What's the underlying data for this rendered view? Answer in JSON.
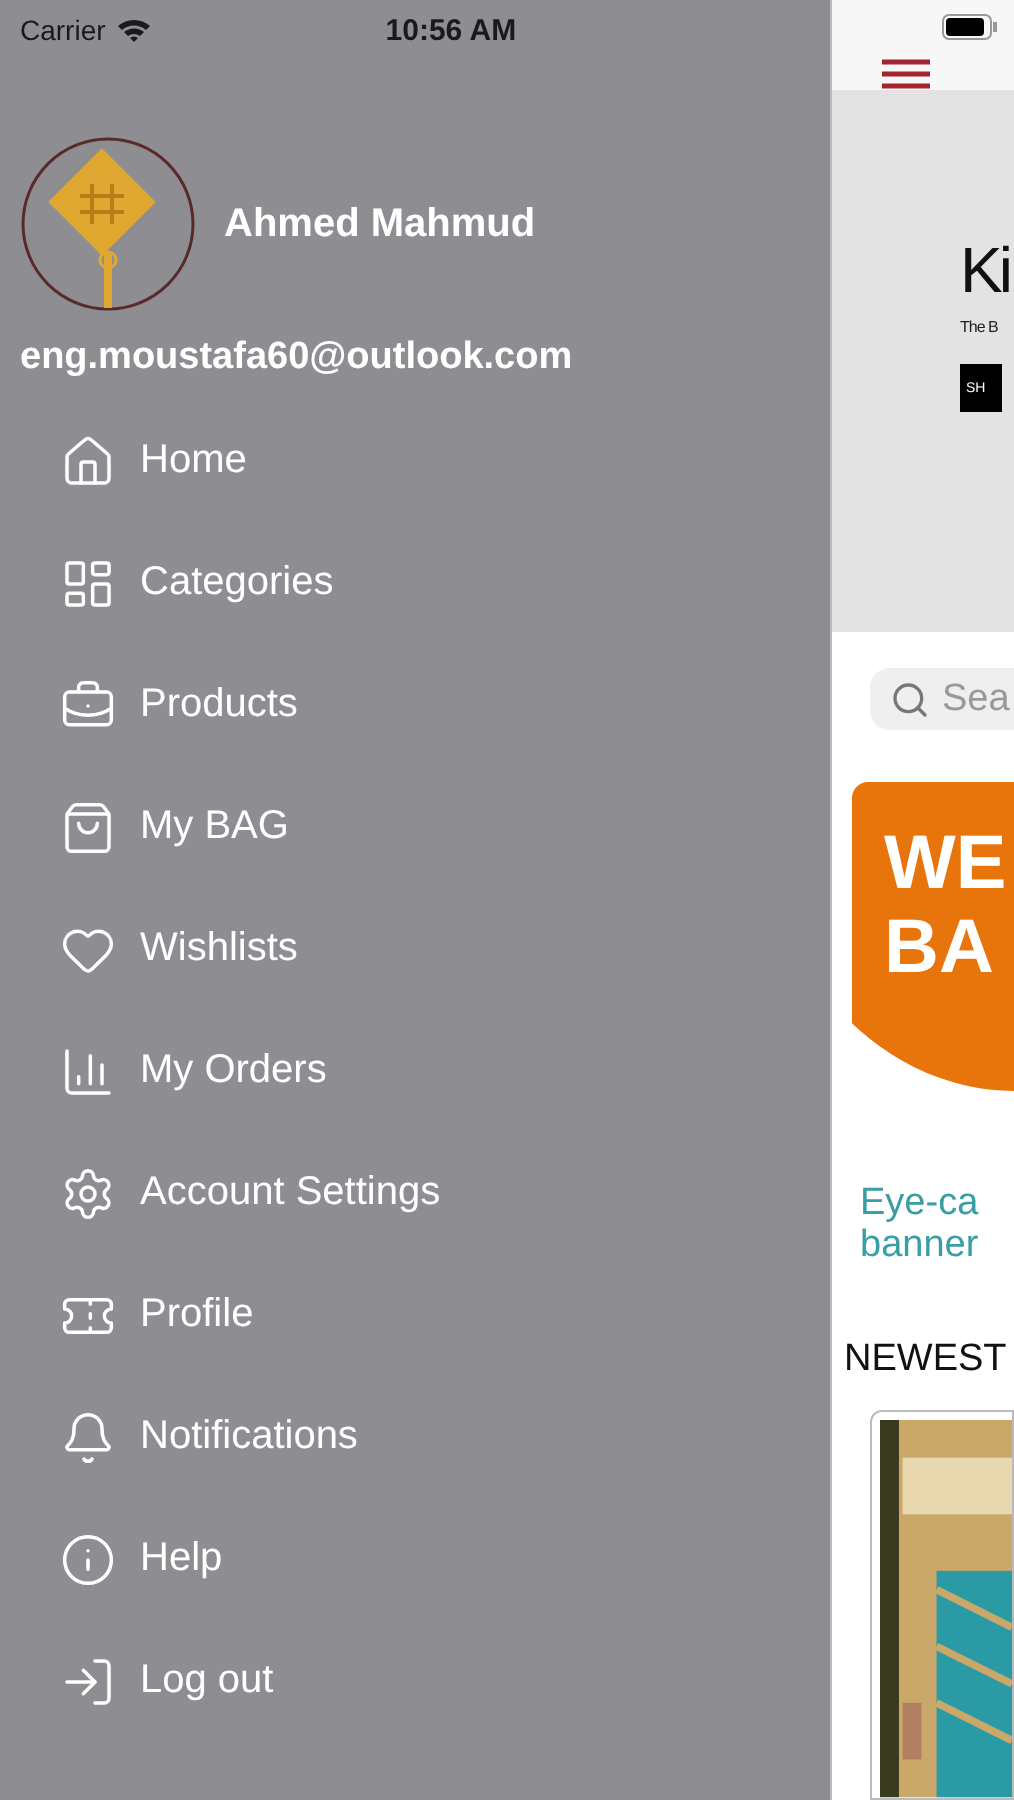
{
  "status_bar": {
    "carrier": "Carrier",
    "time": "10:56 AM"
  },
  "drawer": {
    "user_name": "Ahmed Mahmud",
    "email": "eng.moustafa60@outlook.com",
    "items": [
      {
        "label": "Home"
      },
      {
        "label": "Categories"
      },
      {
        "label": "Products"
      },
      {
        "label": "My BAG"
      },
      {
        "label": "Wishlists"
      },
      {
        "label": "My Orders"
      },
      {
        "label": "Account Settings"
      },
      {
        "label": "Profile"
      },
      {
        "label": "Notifications"
      },
      {
        "label": "Help"
      },
      {
        "label": "Log out"
      }
    ]
  },
  "main": {
    "hero": {
      "title": "Ki",
      "subtitle": "The B",
      "button": "SH"
    },
    "search": {
      "placeholder": "Sea"
    },
    "promo": {
      "title_lines": [
        "WE",
        "BA"
      ],
      "caption_lines": [
        "Eye-ca",
        "banner"
      ]
    },
    "section_title": "NEWEST"
  }
}
